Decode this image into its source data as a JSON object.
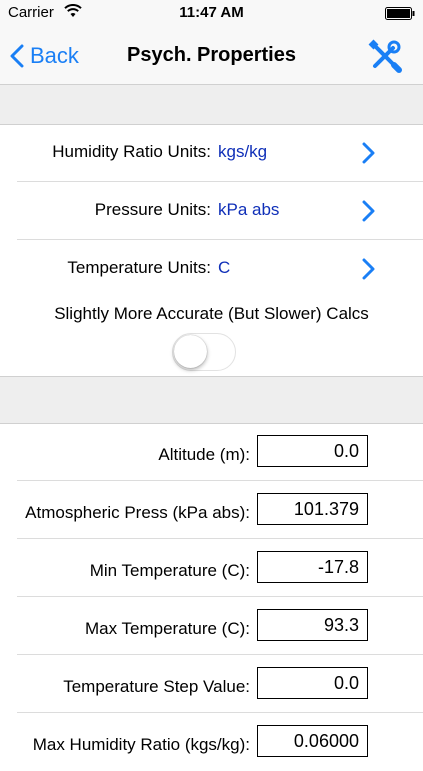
{
  "status_bar": {
    "carrier": "Carrier",
    "time": "11:47 AM"
  },
  "nav": {
    "back_label": "Back",
    "title": "Psych. Properties",
    "tools_icon": "wrench-screwdriver-icon"
  },
  "units": [
    {
      "label": "Humidity Ratio Units:",
      "value": "kgs/kg"
    },
    {
      "label": "Pressure Units:",
      "value": "kPa abs"
    },
    {
      "label": "Temperature Units:",
      "value": "C"
    }
  ],
  "accurate_calcs": {
    "label": "Slightly More Accurate (But Slower) Calcs",
    "enabled": false
  },
  "fields": [
    {
      "label": "Altitude (m):",
      "value": "0.0"
    },
    {
      "label": "Atmospheric Press (kPa abs):",
      "value": "101.379"
    },
    {
      "label": "Min Temperature (C):",
      "value": "-17.8"
    },
    {
      "label": "Max Temperature (C):",
      "value": "93.3"
    },
    {
      "label": "Temperature Step Value:",
      "value": "0.0"
    },
    {
      "label": "Max Humidity Ratio (kgs/kg):",
      "value": "0.06000"
    }
  ],
  "colors": {
    "accent": "#1a7ff5",
    "unit_value": "#0f2fb8",
    "section_bg": "#eeeeee"
  }
}
